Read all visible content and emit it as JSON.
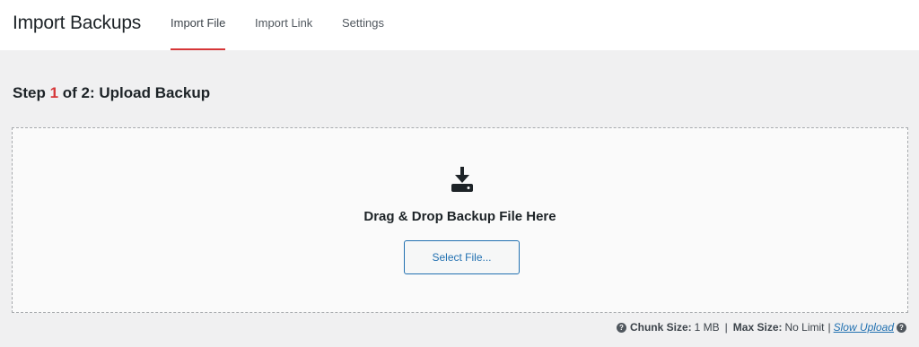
{
  "header": {
    "title": "Import Backups",
    "tabs": [
      {
        "label": "Import File",
        "active": true
      },
      {
        "label": "Import Link",
        "active": false
      },
      {
        "label": "Settings",
        "active": false
      }
    ]
  },
  "step": {
    "prefix": "Step ",
    "number": "1",
    "suffix": " of 2: Upload Backup"
  },
  "dropzone": {
    "icon": "download-icon",
    "text": "Drag & Drop Backup File Here",
    "button_label": "Select File..."
  },
  "footer": {
    "chunk_label": "Chunk Size:",
    "chunk_value": "1 MB",
    "separator": "|",
    "max_label": "Max Size:",
    "max_value": "No Limit",
    "slow_upload": "Slow Upload",
    "help_icon": "question-circle-icon"
  },
  "colors": {
    "accent_red": "#d63638",
    "link_blue": "#2271b1",
    "background": "#f0f0f1"
  }
}
